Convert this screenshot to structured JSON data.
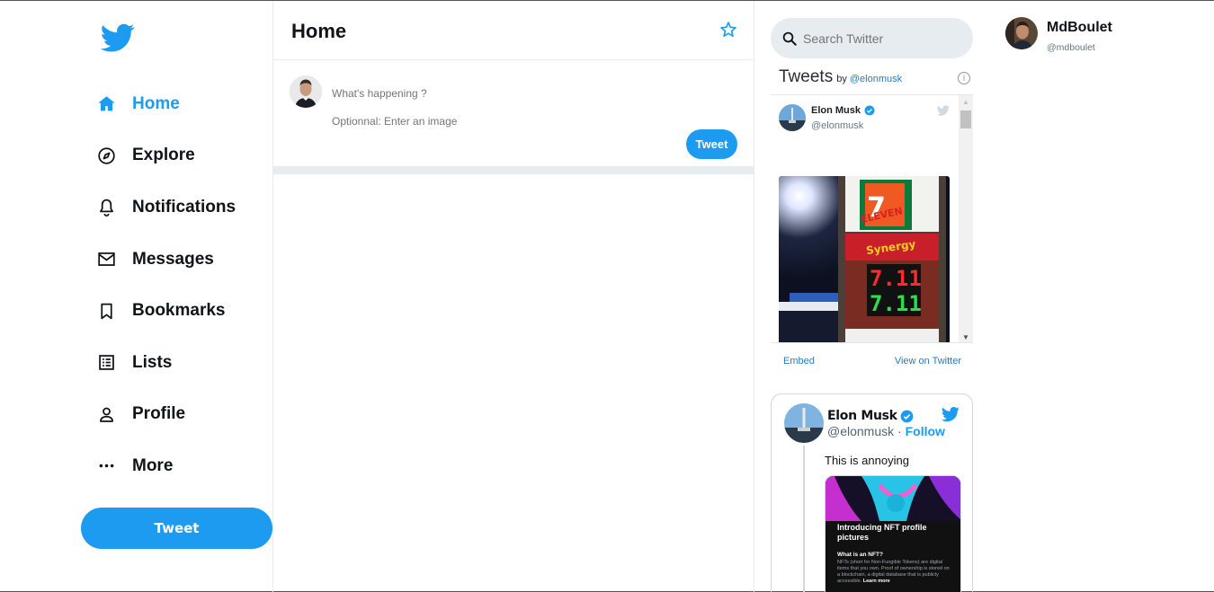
{
  "sidebar": {
    "items": [
      {
        "label": "Home",
        "icon": "home-icon"
      },
      {
        "label": "Explore",
        "icon": "explore-icon"
      },
      {
        "label": "Notifications",
        "icon": "bell-icon"
      },
      {
        "label": "Messages",
        "icon": "mail-icon"
      },
      {
        "label": "Bookmarks",
        "icon": "bookmark-icon"
      },
      {
        "label": "Lists",
        "icon": "list-icon"
      },
      {
        "label": "Profile",
        "icon": "person-icon"
      },
      {
        "label": "More",
        "icon": "more-icon"
      }
    ],
    "tweet_button": "Tweet"
  },
  "main": {
    "title": "Home",
    "composer": {
      "text_placeholder": "What's happening ?",
      "image_placeholder": "Optionnal: Enter an image",
      "tweet_button": "Tweet"
    }
  },
  "widgets": {
    "search_placeholder": "Search Twitter",
    "timeline": {
      "title": "Tweets",
      "by_prefix": "by",
      "by_handle": "@elonmusk",
      "tweet": {
        "name": "Elon Musk",
        "handle": "@elonmusk"
      },
      "embed_link": "Embed",
      "view_link": "View on Twitter"
    },
    "embed_card": {
      "name": "Elon Musk",
      "handle": "@elonmusk",
      "separator": "·",
      "follow": "Follow",
      "text": "This is annoying",
      "image": {
        "title": "Introducing NFT profile pictures",
        "question": "What is an NFT?",
        "body": "NFTs (short for Non-Fungible Tokens) are digital items that you own. Proof of ownership is stored on a blockchain, a digital database that is publicly accessible.",
        "more": "Learn more"
      }
    }
  },
  "profile": {
    "name": "MdBoulet",
    "handle": "@mdboulet"
  },
  "colors": {
    "accent": "#1d9bf0",
    "divider": "#e6ecf0"
  }
}
